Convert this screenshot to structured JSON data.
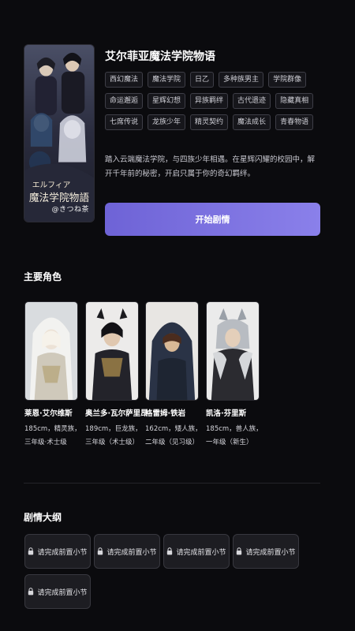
{
  "story": {
    "title": "艾尔菲亚魔法学院物语",
    "tags": [
      "西幻魔法",
      "魔法学院",
      "日乙",
      "多种族男主",
      "学院群像",
      "命运邂逅",
      "星辉幻想",
      "异族羁绊",
      "古代遗迹",
      "隐藏真相",
      "七席传说",
      "龙族少年",
      "精灵契约",
      "魔法成长",
      "青春物语"
    ],
    "description": "踏入云端魔法学院，与四族少年相遇。在星辉闪耀的校园中，解开千年前的秘密，开启只属于你的奇幻羁绊。",
    "cover_signature": "@きつね茶",
    "start_label": "开始剧情"
  },
  "characters_section": {
    "title": "主要角色",
    "items": [
      {
        "name": "莱恩·艾尔维斯",
        "info": "185cm，精灵族，三年级·术士级"
      },
      {
        "name": "奥兰多·瓦尔萨里昂",
        "info": "189cm，巨龙族，三年级（术士级）"
      },
      {
        "name": "格雷姆·铁岩",
        "info": "162cm，矮人族，二年级（见习级）"
      },
      {
        "name": "凯洛·芬里斯",
        "info": "185cm，兽人族，一年级（新生）"
      }
    ]
  },
  "outline_section": {
    "title": "剧情大纲",
    "locked_label": "请完成前置小节",
    "locked_count": 5
  },
  "icons": {
    "lock": "lock-icon"
  },
  "colors": {
    "accent": "#7a70e0",
    "background": "#0b0b0e"
  }
}
